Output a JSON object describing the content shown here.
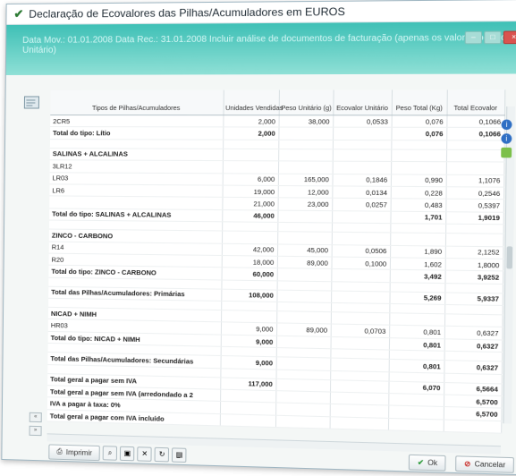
{
  "window": {
    "title": "Declaração de Ecovalores das Pilhas/Acumuladores em EUROS",
    "banner_info": "Data Mov.: 01.01.2008   Data Rec.: 31.01.2008  Incluir análise de documentos de facturação (apenas os valores por Ecovalor Unitário)",
    "controls": [
      "–",
      "□",
      "×"
    ]
  },
  "table": {
    "columns": [
      "Tipos de Pilhas/Acumuladores",
      "Unidades Vendidas",
      "Peso Unitário (g)",
      "Ecovalor Unitário",
      "Peso Total (Kg)",
      "Total Ecovalor"
    ],
    "rows": [
      {
        "kind": "data",
        "cells": [
          "2CR5",
          "2,000",
          "38,000",
          "0,0533",
          "0,076",
          "0,1066"
        ]
      },
      {
        "kind": "bold",
        "cells": [
          "Total do tipo: Lítio",
          "2,000",
          "",
          "",
          "0,076",
          "0,1066"
        ]
      },
      {
        "kind": "sep",
        "cells": [
          "",
          "",
          "",
          "",
          "",
          ""
        ]
      },
      {
        "kind": "bold",
        "cells": [
          "SALINAS + ALCALINAS",
          "",
          "",
          "",
          "",
          ""
        ]
      },
      {
        "kind": "data",
        "cells": [
          "3LR12",
          "",
          "",
          "",
          "",
          ""
        ]
      },
      {
        "kind": "data",
        "cells": [
          "LR03",
          "6,000",
          "165,000",
          "0,1846",
          "0,990",
          "1,1076"
        ]
      },
      {
        "kind": "data",
        "cells": [
          "LR6",
          "19,000",
          "12,000",
          "0,0134",
          "0,228",
          "0,2546"
        ]
      },
      {
        "kind": "data",
        "cells": [
          "",
          "21,000",
          "23,000",
          "0,0257",
          "0,483",
          "0,5397"
        ]
      },
      {
        "kind": "bold",
        "cells": [
          "Total do tipo: SALINAS + ALCALINAS",
          "46,000",
          "",
          "",
          "1,701",
          "1,9019"
        ]
      },
      {
        "kind": "sep",
        "cells": [
          "",
          "",
          "",
          "",
          "",
          ""
        ]
      },
      {
        "kind": "bold",
        "cells": [
          "ZINCO - CARBONO",
          "",
          "",
          "",
          "",
          ""
        ]
      },
      {
        "kind": "data",
        "cells": [
          "R14",
          "42,000",
          "45,000",
          "0,0506",
          "1,890",
          "2,1252"
        ]
      },
      {
        "kind": "data",
        "cells": [
          "R20",
          "18,000",
          "89,000",
          "0,1000",
          "1,602",
          "1,8000"
        ]
      },
      {
        "kind": "bold",
        "cells": [
          "Total do tipo: ZINCO - CARBONO",
          "60,000",
          "",
          "",
          "3,492",
          "3,9252"
        ]
      },
      {
        "kind": "sep",
        "cells": [
          "",
          "",
          "",
          "",
          "",
          ""
        ]
      },
      {
        "kind": "bold",
        "cells": [
          "Total das Pilhas/Acumuladores: Primárias",
          "108,000",
          "",
          "",
          "5,269",
          "5,9337"
        ]
      },
      {
        "kind": "sep",
        "cells": [
          "",
          "",
          "",
          "",
          "",
          ""
        ]
      },
      {
        "kind": "bold",
        "cells": [
          "NICAD + NIMH",
          "",
          "",
          "",
          "",
          ""
        ]
      },
      {
        "kind": "data",
        "cells": [
          "HR03",
          "9,000",
          "89,000",
          "0,0703",
          "0,801",
          "0,6327"
        ]
      },
      {
        "kind": "bold",
        "cells": [
          "Total do tipo: NICAD + NIMH",
          "9,000",
          "",
          "",
          "0,801",
          "0,6327"
        ]
      },
      {
        "kind": "sep",
        "cells": [
          "",
          "",
          "",
          "",
          "",
          ""
        ]
      },
      {
        "kind": "bold",
        "cells": [
          "Total das Pilhas/Acumuladores: Secundárias",
          "9,000",
          "",
          "",
          "0,801",
          "0,6327"
        ]
      },
      {
        "kind": "sep",
        "cells": [
          "",
          "",
          "",
          "",
          "",
          ""
        ]
      },
      {
        "kind": "bold",
        "cells": [
          "Total geral a pagar sem IVA",
          "117,000",
          "",
          "",
          "6,070",
          "6,5664"
        ]
      },
      {
        "kind": "bold",
        "cells": [
          "Total geral a pagar sem IVA (arredondado a 2",
          "",
          "",
          "",
          "",
          "6,5700"
        ]
      },
      {
        "kind": "bold",
        "cells": [
          "IVA a pagar à taxa: 0%",
          "",
          "",
          "",
          "",
          "6,5700"
        ]
      },
      {
        "kind": "bold",
        "cells": [
          "Total geral a pagar com IVA incluído",
          "",
          "",
          "",
          "",
          ""
        ]
      }
    ]
  },
  "footer": {
    "print_label": "Imprimir",
    "ok_label": "Ok",
    "cancel_label": "Cancelar"
  }
}
